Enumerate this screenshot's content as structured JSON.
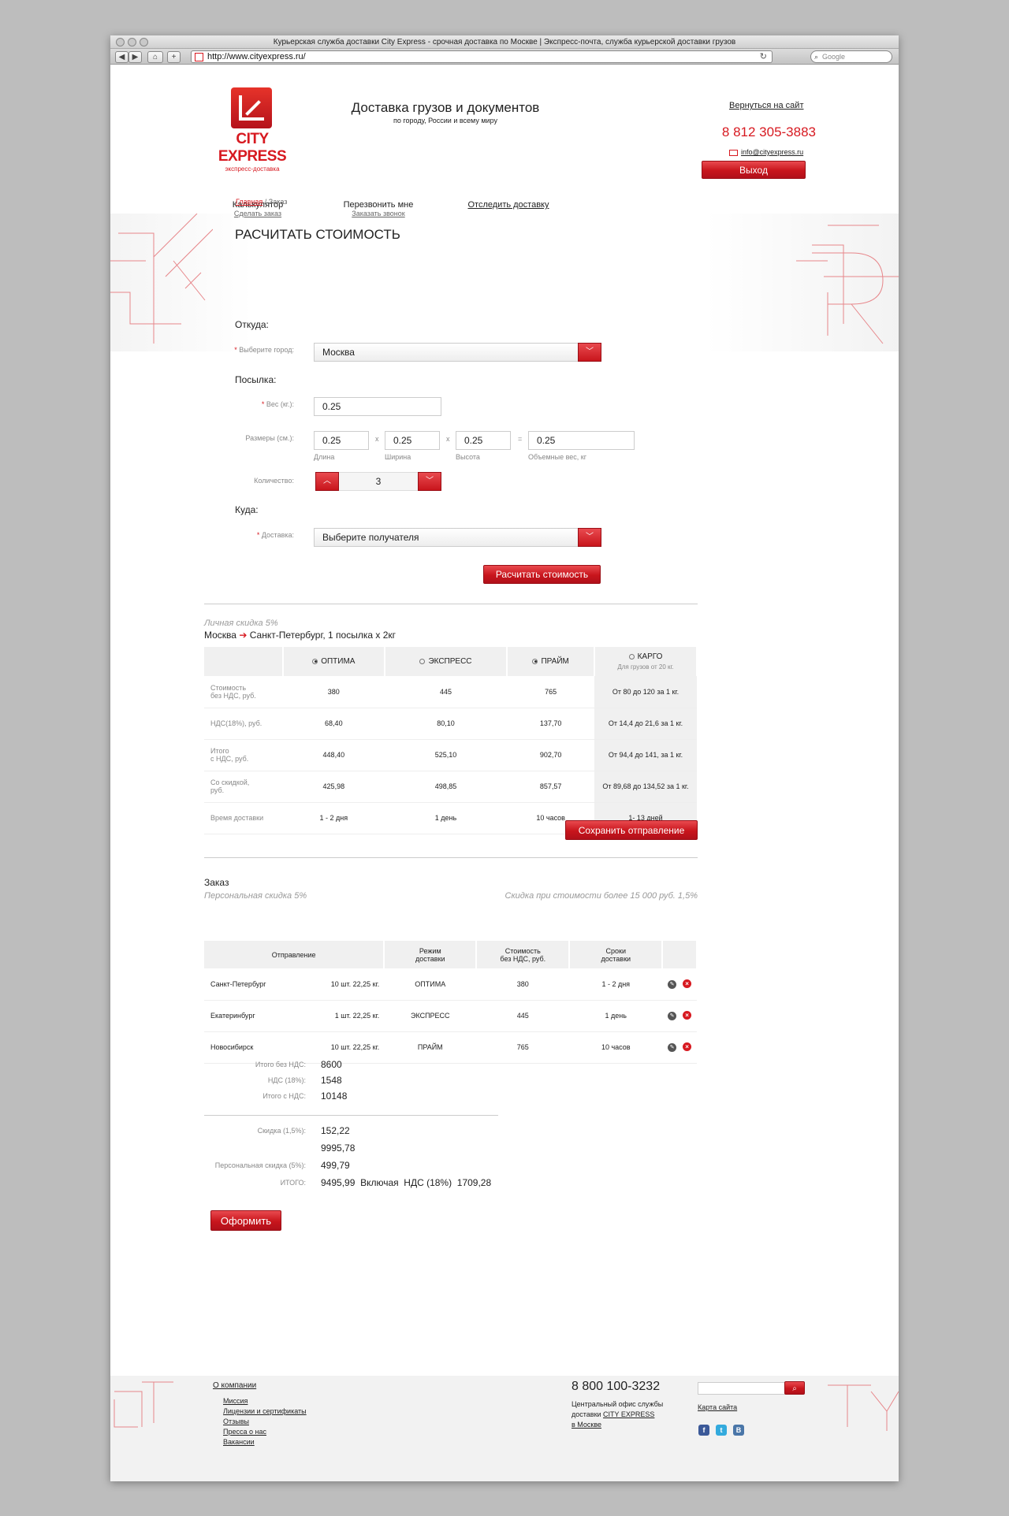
{
  "browser": {
    "window_title": "Курьерская служба доставки City Express - срочная доставка по Москве | Экспресс-почта, служба курьерской доставки грузов",
    "url": "http://www.cityexpress.ru/",
    "search_placeholder": "Google"
  },
  "header": {
    "logo_name": "CITY EXPRESS",
    "logo_sub": "экспресс-доставка",
    "slogan_title": "Доставка грузов и документов",
    "slogan_sub": "по городу, России и всему миру",
    "back_link": "Вернуться на сайт",
    "phone": "8 812 305-3883",
    "email": "info@cityexpress.ru",
    "exit_label": "Выход"
  },
  "nav": [
    {
      "label": "Калькулятор",
      "sub": "Сделать заказ"
    },
    {
      "label": "Перезвонить мне",
      "sub": "Заказать звонок"
    },
    {
      "label": "Отследить доставку",
      "sub": ""
    }
  ],
  "breadcrumbs": {
    "home": "Главная",
    "sep": " / ",
    "current": "Заказ"
  },
  "calc": {
    "title": "РАСЧИТАТЬ СТОИМОСТЬ",
    "from_title": "Откуда:",
    "city_label": "Выберите город:",
    "city_value": "Москва",
    "parcel_title": "Посылка:",
    "weight_label": "Вес (кг.):",
    "weight_value": "0.25",
    "dims_label": "Размеры (см.):",
    "length_value": "0.25",
    "width_value": "0.25",
    "height_value": "0.25",
    "volume_value": "0.25",
    "length_label": "Длина",
    "width_label": "Ширина",
    "height_label": "Высота",
    "volume_label": "Объемные вес, кг",
    "times": "x",
    "equals": "=",
    "qty_label": "Количество:",
    "qty_value": "3",
    "to_title": "Куда:",
    "delivery_label": "Доставка:",
    "delivery_value": "Выберите получателя",
    "calc_button": "Расчитать стоимость"
  },
  "rates": {
    "discount": "Личная скидка 5%",
    "route_from": "Москва",
    "route_to": "Санкт-Петербург, 1 посылка х 2кг",
    "columns": [
      {
        "label": "ОПТИМА",
        "checked": true,
        "note": ""
      },
      {
        "label": "ЭКСПРЕСС",
        "checked": false,
        "note": ""
      },
      {
        "label": "ПРАЙМ",
        "checked": true,
        "note": ""
      },
      {
        "label": "КАРГО",
        "checked": false,
        "note": "Для грузов от 20 кг."
      }
    ],
    "rows": [
      {
        "label": "Стоимость\nбез НДС, руб.",
        "values": [
          "380",
          "445",
          "765",
          "От 80 до 120 за 1 кг."
        ]
      },
      {
        "label": "НДС(18%), руб.",
        "values": [
          "68,40",
          "80,10",
          "137,70",
          "От 14,4 до 21,6 за 1 кг."
        ]
      },
      {
        "label": "Итого\nс НДС, руб.",
        "values": [
          "448,40",
          "525,10",
          "902,70",
          "От 94,4 до 141, за 1 кг."
        ]
      },
      {
        "label": "Со скидкой,\nруб.",
        "values": [
          "425,98",
          "498,85",
          "857,57",
          "От 89,68 до 134,52 за 1 кг."
        ]
      },
      {
        "label": "Время доставки",
        "values": [
          "1 - 2 дня",
          "1 день",
          "10 часов",
          "1- 13 дней"
        ]
      }
    ],
    "save_button": "Сохранить отправление"
  },
  "order": {
    "title": "Заказ",
    "personal_discount": "Персональная скидка 5%",
    "bulk_discount": "Скидка при стоимости более 15 000 руб. 1,5%",
    "columns": [
      "Отправление",
      "Режим\nдоставки",
      "Стоимость\nбез НДС, руб.",
      "Сроки\nдоставки"
    ],
    "rows": [
      {
        "city": "Санкт-Петербург",
        "qty": "10 шт. 22,25 кг.",
        "mode": "ОПТИМА",
        "cost": "380",
        "term": "1 - 2 дня"
      },
      {
        "city": "Екатеринбург",
        "qty": "1 шт. 22,25 кг.",
        "mode": "ЭКСПРЕСС",
        "cost": "445",
        "term": "1 день"
      },
      {
        "city": "Новосибирск",
        "qty": "10 шт. 22,25 кг.",
        "mode": "ПРАЙМ",
        "cost": "765",
        "term": "10 часов"
      }
    ]
  },
  "summary": {
    "total_no_vat_label": "Итого без НДС:",
    "total_no_vat": "8600",
    "vat_label": "НДС (18%):",
    "vat": "1548",
    "total_vat_label": "Итого с НДС:",
    "total_vat": "10148",
    "discount_label": "Скидка (1,5%):",
    "discount": "152,22",
    "subtotal": "9995,78",
    "personal_label": "Персональная скидка (5%):",
    "personal": "499,79",
    "grand_label": "ИТОГО:",
    "grand": "9495,99",
    "incl": "Включая",
    "incl_vat_label": "НДС (18%)",
    "incl_vat": "1709,28",
    "submit_button": "Оформить"
  },
  "footer": {
    "about": "О компании",
    "links": [
      "Миссия",
      "Лицензии и сертификаты",
      "Отзывы",
      "Пресса о нас",
      "Вакансии"
    ],
    "phone": "8 800 100-3232",
    "office_line1": "Центральный офис службы",
    "office_line2_prefix": "доставки ",
    "office_brand": "CITY EXPRESS",
    "office_line3": "в Москве",
    "sitemap": "Карта сайта",
    "social": [
      "f",
      "t",
      "B"
    ]
  },
  "colors": {
    "accent": "#d71920",
    "panel": "#f0f0f0"
  }
}
